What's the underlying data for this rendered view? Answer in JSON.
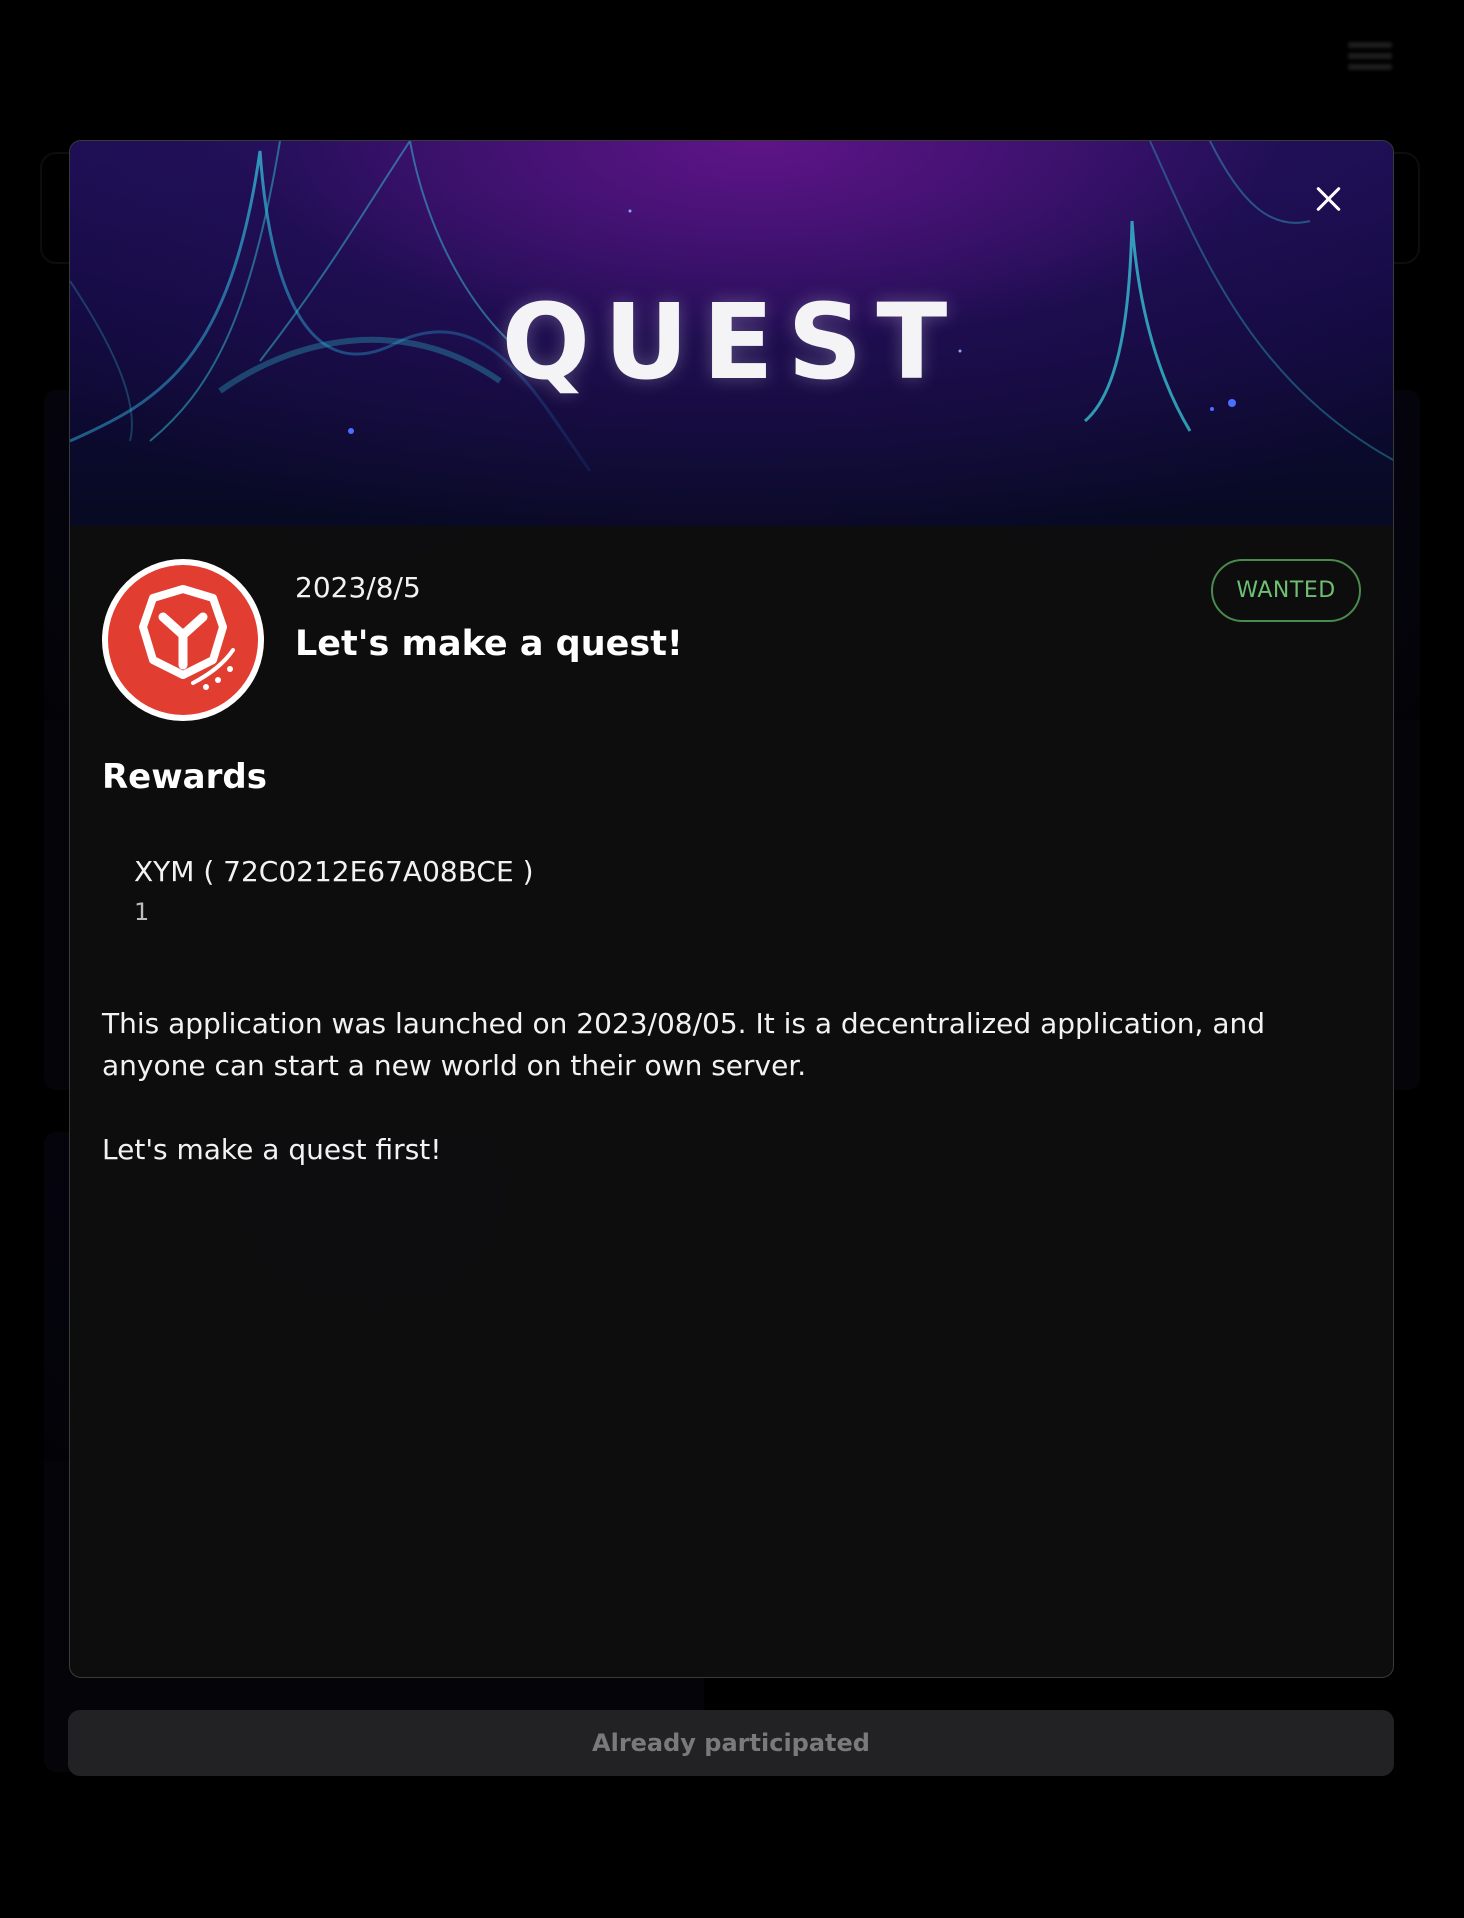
{
  "hero": {
    "banner_text": "QUEST"
  },
  "quest": {
    "date": "2023/8/5",
    "title": "Let's make a quest!",
    "status": "WANTED",
    "status_color": "#6fbf73",
    "avatar_color": "#e13d30"
  },
  "rewards": {
    "heading": "Rewards",
    "items": [
      {
        "name": "XYM ( 72C0212E67A08BCE )",
        "amount": "1"
      }
    ]
  },
  "description": [
    "This application was launched on 2023/08/05. It is a decentralized application, and anyone can start a new world on their own server.",
    "Let's make a quest first!"
  ],
  "actions": {
    "participate_label": "Already participated"
  },
  "icons": {
    "close": "close-icon",
    "menu": "hamburger-menu-icon"
  }
}
